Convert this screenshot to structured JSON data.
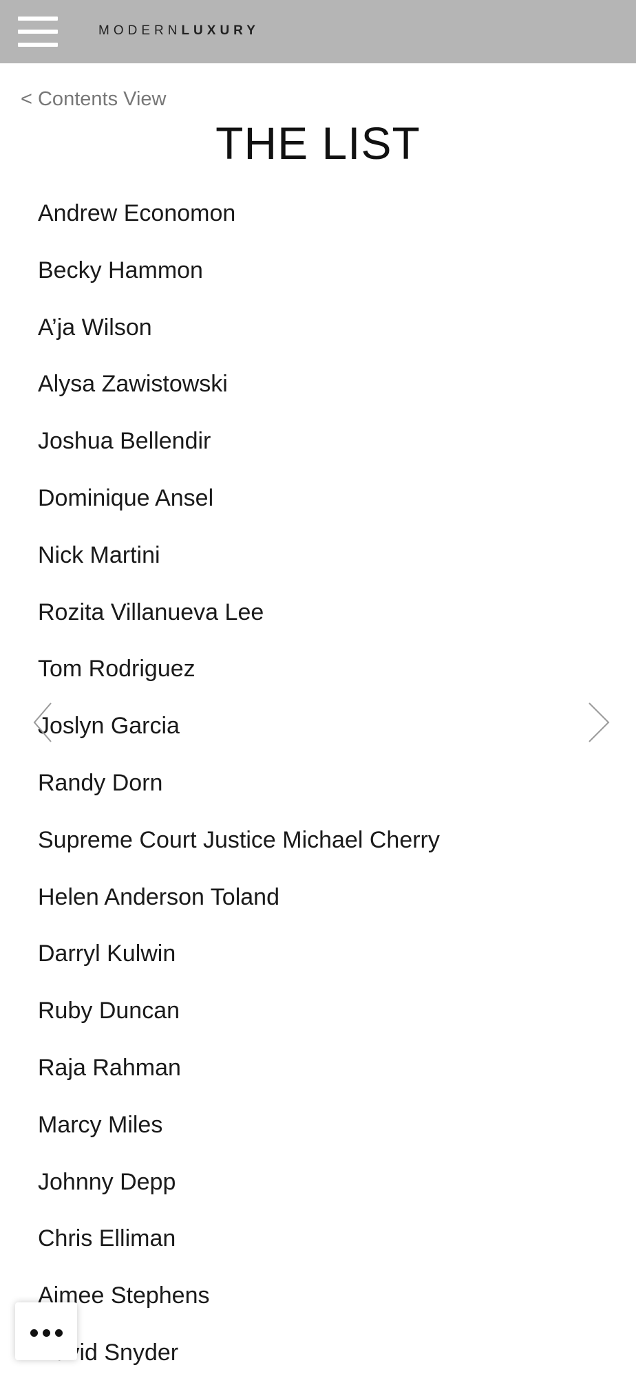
{
  "header": {
    "menu_icon": "hamburger-menu-icon",
    "logo_light": "MODERN",
    "logo_bold": "LUXURY",
    "background": "#b5b5b5"
  },
  "nav": {
    "back_label": "< Contents View"
  },
  "main": {
    "title": "THE LIST",
    "items": [
      "Andrew Economon",
      "Becky Hammon",
      "A’ja Wilson",
      "Alysa Zawistowski",
      "Joshua Bellendir",
      "Dominique Ansel",
      "Nick Martini",
      "Rozita Villanueva Lee",
      "Tom Rodriguez",
      "Joslyn Garcia",
      "Randy Dorn",
      "Supreme Court Justice Michael Cherry",
      "Helen Anderson Toland",
      "Darryl Kulwin",
      "Ruby Duncan",
      "Raja Rahman",
      "Marcy Miles",
      "Johnny Depp",
      "Chris Elliman",
      "Aimee Stephens",
      "David Snyder"
    ]
  },
  "controls": {
    "prev_icon": "chevron-left-icon",
    "next_icon": "chevron-right-icon",
    "more_icon": "more-dots-icon"
  }
}
